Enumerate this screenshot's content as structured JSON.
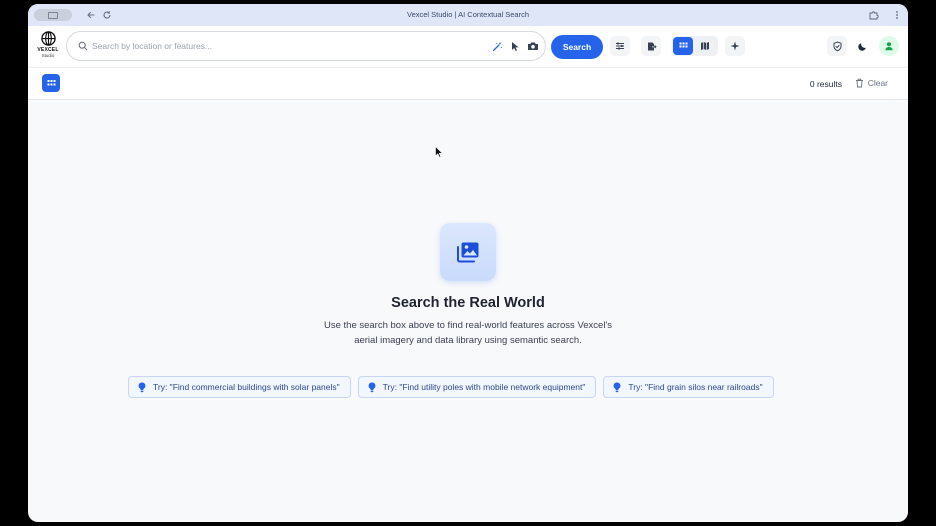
{
  "window": {
    "title": "Vexcel Studio | AI Contextual Search"
  },
  "logo": {
    "line1": "VEXCEL",
    "line2": "Studio"
  },
  "search": {
    "placeholder": "Search by location or features...",
    "value": "",
    "button_label": "Search"
  },
  "subbar": {
    "results_label": "0 results",
    "clear_label": "Clear"
  },
  "empty_state": {
    "title": "Search the Real World",
    "description": "Use the search box above to find real-world features across Vexcel's aerial imagery and data library using semantic search."
  },
  "suggestions": [
    {
      "label": "Try: \"Find commercial buildings with solar panels\""
    },
    {
      "label": "Try: \"Find utility poles with mobile network equipment\""
    },
    {
      "label": "Try: \"Find grain silos near railroads\""
    }
  ],
  "icons": {
    "search": "search-icon",
    "magic": "magic-wand-icon",
    "pointer": "pointer-icon",
    "camera": "camera-icon",
    "filters": "sliders-icon",
    "export": "export-icon",
    "grid_view": "grid-icon",
    "map_view": "map-icon",
    "sparkle": "sparkle-icon",
    "shield": "shield-check-icon",
    "dark_mode": "moon-icon",
    "user": "user-icon",
    "trash": "trash-icon",
    "bulb": "lightbulb-icon",
    "gallery": "image-gallery-icon"
  },
  "colors": {
    "accent": "#2563eb",
    "titlebar": "#dfe6f7",
    "chip_bg": "#f2f6fe",
    "chip_text": "#2b4a8c",
    "avatar_bg": "#dcfce7",
    "avatar_fg": "#16a34a"
  }
}
